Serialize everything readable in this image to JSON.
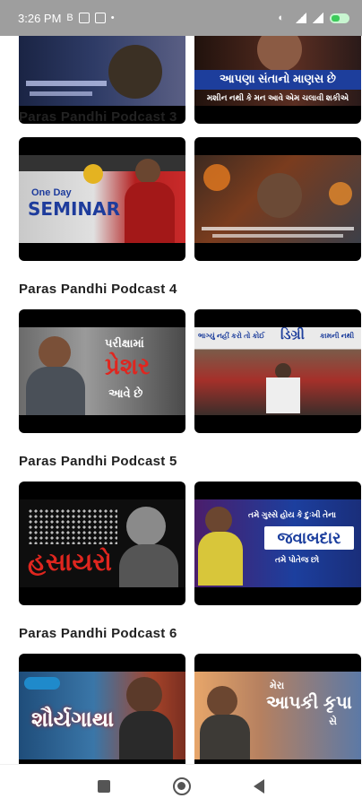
{
  "status_bar": {
    "time": "3:26 PM",
    "icon_b": "B"
  },
  "top_row": [
    {
      "caption": ""
    },
    {
      "caption": "આપણા સંતાનો માણસ છે",
      "subcaption": "મશીન નથી કે મન આવે એમ ચલાવી શકીએ"
    }
  ],
  "sections": [
    {
      "title": "Paras Pandhi Podcast 3",
      "videos": [
        {
          "caption_top": "One Day",
          "caption_main": "SEMINAR"
        },
        {
          "caption": ""
        }
      ]
    },
    {
      "title": "Paras Pandhi Podcast 4",
      "videos": [
        {
          "caption_top": "પરીક્ષામાં",
          "caption_main": "પ્રેશર",
          "caption_bottom": "આવે છે"
        },
        {
          "caption_top": "ભાગ્યું નહીં કરો તો કોઈ",
          "caption_main": "ડિગ્રી",
          "caption_bottom": "કામની નથી"
        }
      ]
    },
    {
      "title": "Paras Pandhi Podcast 5",
      "videos": [
        {
          "caption_main": "હસાયરો"
        },
        {
          "caption_top": "તમે ગુસ્સે હોય કે દુઃખી તેના",
          "caption_main": "જવાબદાર",
          "caption_bottom": "તમે પોતેજ છો"
        }
      ]
    },
    {
      "title": "Paras Pandhi Podcast 6",
      "videos": [
        {
          "caption_main": "શૌર્યગાથા"
        },
        {
          "caption_top": "મેરા",
          "caption_main": "આપકી કૃપા",
          "caption_bottom": "સે"
        }
      ]
    }
  ]
}
